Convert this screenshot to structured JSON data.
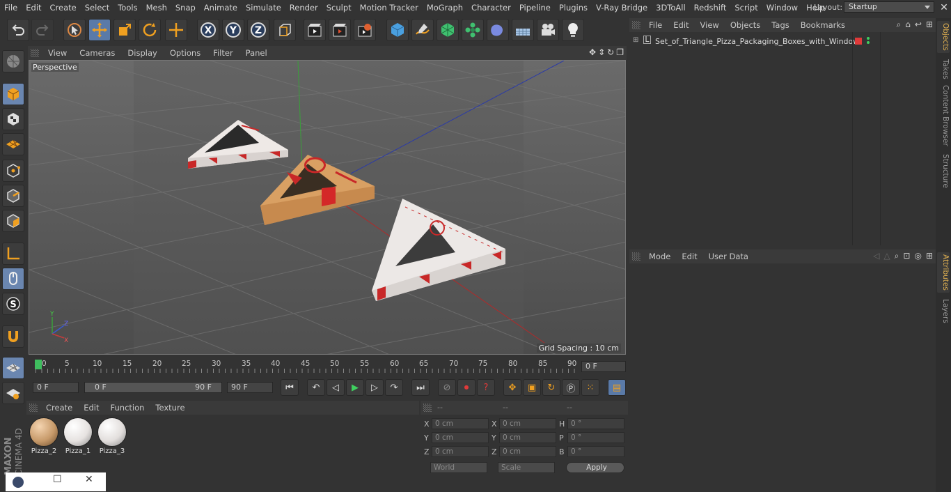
{
  "menubar": {
    "items": [
      "File",
      "Edit",
      "Create",
      "Select",
      "Tools",
      "Mesh",
      "Snap",
      "Animate",
      "Simulate",
      "Render",
      "Sculpt",
      "Motion Tracker",
      "MoGraph",
      "Character",
      "Pipeline",
      "Plugins",
      "V-Ray Bridge",
      "3DToAll",
      "Redshift",
      "Script",
      "Window",
      "Help"
    ],
    "layout_label": "Layout:",
    "layout_value": "Startup"
  },
  "toolbar": {
    "tools": [
      "undo-icon",
      "redo-icon",
      "select-arrow-icon",
      "move-icon",
      "scale-icon",
      "rotate-icon",
      "live-move-icon",
      "x-axis-icon",
      "y-axis-icon",
      "z-axis-icon",
      "coordinate-system-icon",
      "render-view-icon",
      "render-picture-viewer-icon",
      "render-settings-icon",
      "cube-primitive-icon",
      "pen-spline-icon",
      "subdivision-icon",
      "cloner-icon",
      "deformer-icon",
      "floor-icon",
      "camera-icon",
      "light-icon"
    ]
  },
  "viewport": {
    "menu": [
      "View",
      "Cameras",
      "Display",
      "Options",
      "Filter",
      "Panel"
    ],
    "label": "Perspective",
    "grid_spacing": "Grid Spacing : 10 cm"
  },
  "timeline": {
    "ticks": [
      "0",
      "5",
      "10",
      "15",
      "20",
      "25",
      "30",
      "35",
      "40",
      "45",
      "50",
      "55",
      "60",
      "65",
      "70",
      "75",
      "80",
      "85",
      "90"
    ],
    "current_frame": "0 F"
  },
  "transport": {
    "start": "0 F",
    "range_start": "0 F",
    "range_end": "90 F",
    "end": "90 F"
  },
  "materials": {
    "menu": [
      "Create",
      "Edit",
      "Function",
      "Texture"
    ],
    "items": [
      {
        "name": "Pizza_2",
        "color": "#c79a6a"
      },
      {
        "name": "Pizza_1",
        "color": "#e6e2e0"
      },
      {
        "name": "Pizza_3",
        "color": "#e2dedc"
      }
    ]
  },
  "coordinates": {
    "headers": [
      "--",
      "--",
      "--"
    ],
    "rows": [
      {
        "a": "X",
        "v1": "0 cm",
        "b": "X",
        "v2": "0 cm",
        "c": "H",
        "v3": "0 °"
      },
      {
        "a": "Y",
        "v1": "0 cm",
        "b": "Y",
        "v2": "0 cm",
        "c": "P",
        "v3": "0 °"
      },
      {
        "a": "Z",
        "v1": "0 cm",
        "b": "Z",
        "v2": "0 cm",
        "c": "B",
        "v3": "0 °"
      }
    ],
    "mode1": "World",
    "mode2": "Scale",
    "apply": "Apply"
  },
  "objects": {
    "menu": [
      "File",
      "Edit",
      "View",
      "Objects",
      "Tags",
      "Bookmarks"
    ],
    "tree": [
      {
        "name": "Set_of_Triangle_Pizza_Packaging_Boxes_with_Window"
      }
    ]
  },
  "attributes": {
    "menu": [
      "Mode",
      "Edit",
      "User Data"
    ]
  },
  "sidetabs": [
    "Objects",
    "Takes",
    "Content Browser",
    "Structure",
    "Attributes",
    "Layers"
  ],
  "logo": {
    "brand": "MAXON",
    "product": "CINEMA 4D"
  },
  "colors": {
    "accent": "#5a7aa8",
    "viewport_bg": "#5c5c5c",
    "panel": "#333333"
  }
}
